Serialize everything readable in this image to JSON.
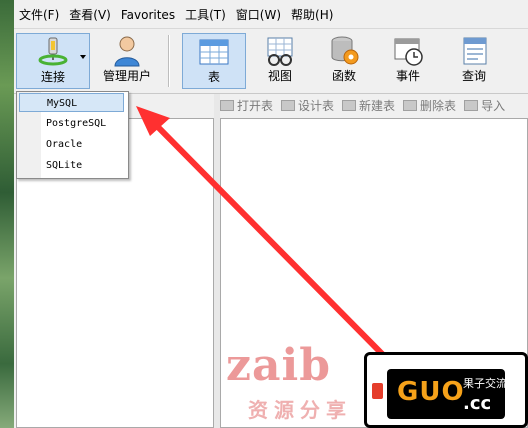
{
  "menubar": {
    "items": [
      "文件(F)",
      "查看(V)",
      "Favorites",
      "工具(T)",
      "窗口(W)",
      "帮助(H)"
    ]
  },
  "toolbar": {
    "connect": "连接",
    "users": "管理用户",
    "table": "表",
    "view": "视图",
    "function": "函数",
    "event": "事件",
    "query": "查询"
  },
  "object_toolbar": {
    "open": "打开表",
    "design": "设计表",
    "new": "新建表",
    "delete": "删除表",
    "import": "导入"
  },
  "connect_menu": {
    "items": [
      "MySQL",
      "PostgreSQL",
      "Oracle",
      "SQLite"
    ],
    "highlighted": "MySQL"
  },
  "watermark": {
    "text": "zaib",
    "subtitle": "资源分享"
  },
  "logo": {
    "brand": "GUO",
    "suffix": ".cc",
    "caption": "果子交流"
  },
  "colors": {
    "annotation_arrow": "#ff3030",
    "highlight": "#d6e7f7",
    "brand_orange": "#f6a21a"
  }
}
